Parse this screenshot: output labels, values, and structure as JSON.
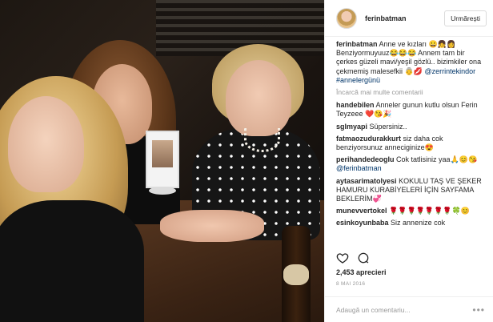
{
  "header": {
    "username": "ferinbatman",
    "follow_label": "Urmărești"
  },
  "caption": {
    "username": "ferinbatman",
    "text": "Anne ve kızları 😀👧👩 Benziyormuyuuz😂😂😂 Annem tam bir çerkes güzeli mavi/yeşil gözlü.. bizimkiler ona çekmemiş malesefkii 👵💋",
    "mention": "@zerrintekindor",
    "hashtag": "#annelergünü"
  },
  "load_more_label": "Încarcă mai multe comentarii",
  "comments": [
    {
      "username": "handebilen",
      "text": "Anneler gunun kutlu olsun Ferin Teyzeee ❤️😘🎉",
      "mention": ""
    },
    {
      "username": "sglmyapi",
      "text": "Süpersiniz..",
      "mention": ""
    },
    {
      "username": "fatmaozudurakkurt",
      "text": "siz daha cok benziyorsunuz anneciginize😍",
      "mention": ""
    },
    {
      "username": "perihandedeoglu",
      "text": "Cok tatlisiniz yaa🙏😊😘",
      "mention": "@ferinbatman"
    },
    {
      "username": "aytasarimatolyesi",
      "text": "KOKULU TAŞ VE ŞEKER HAMURU KURABİYELERİ İÇİN SAYFAMA BEKLERİM💞",
      "mention": ""
    },
    {
      "username": "munevvertokel",
      "text": "🌹🌹🌹🌹🌹🌹🌹🍀😊",
      "mention": ""
    },
    {
      "username": "esinkoyunbaba",
      "text": "Siz annenize cok",
      "mention": ""
    }
  ],
  "likes_label": "2,453 aprecieri",
  "date_label": "8 MAI 2016",
  "add_comment": {
    "placeholder": "Adaugă un comentariu..."
  },
  "colors": {
    "mention": "#003569",
    "muted": "#999999",
    "border": "#efefef"
  },
  "icons": [
    "heart-icon",
    "comment-icon",
    "more-options-icon"
  ]
}
